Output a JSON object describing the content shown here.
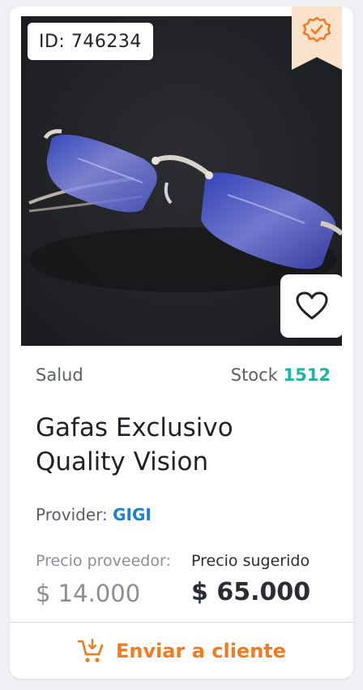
{
  "product": {
    "id_label": "ID: 746234",
    "category": "Salud",
    "stock_label": "Stock",
    "stock_value": "1512",
    "title": "Gafas Exclusivo Quality Vision",
    "provider_label": "Provider:",
    "provider_name": "GIGI",
    "price_provider_label": "Precio proveedor:",
    "price_provider": "$ 14.000",
    "price_suggested_label": "Precio sugerido",
    "price_suggested": "$ 65.000"
  },
  "actions": {
    "send_label": "Enviar a cliente",
    "send_icon": "cart-arrow-icon",
    "favorite_icon": "heart-icon",
    "verified_icon": "verified-badge-icon"
  },
  "colors": {
    "accent_orange": "#f37b1d",
    "stock_teal": "#19b7a3",
    "provider_blue": "#1f7fd6",
    "ribbon_bg": "#fbe2cd"
  }
}
